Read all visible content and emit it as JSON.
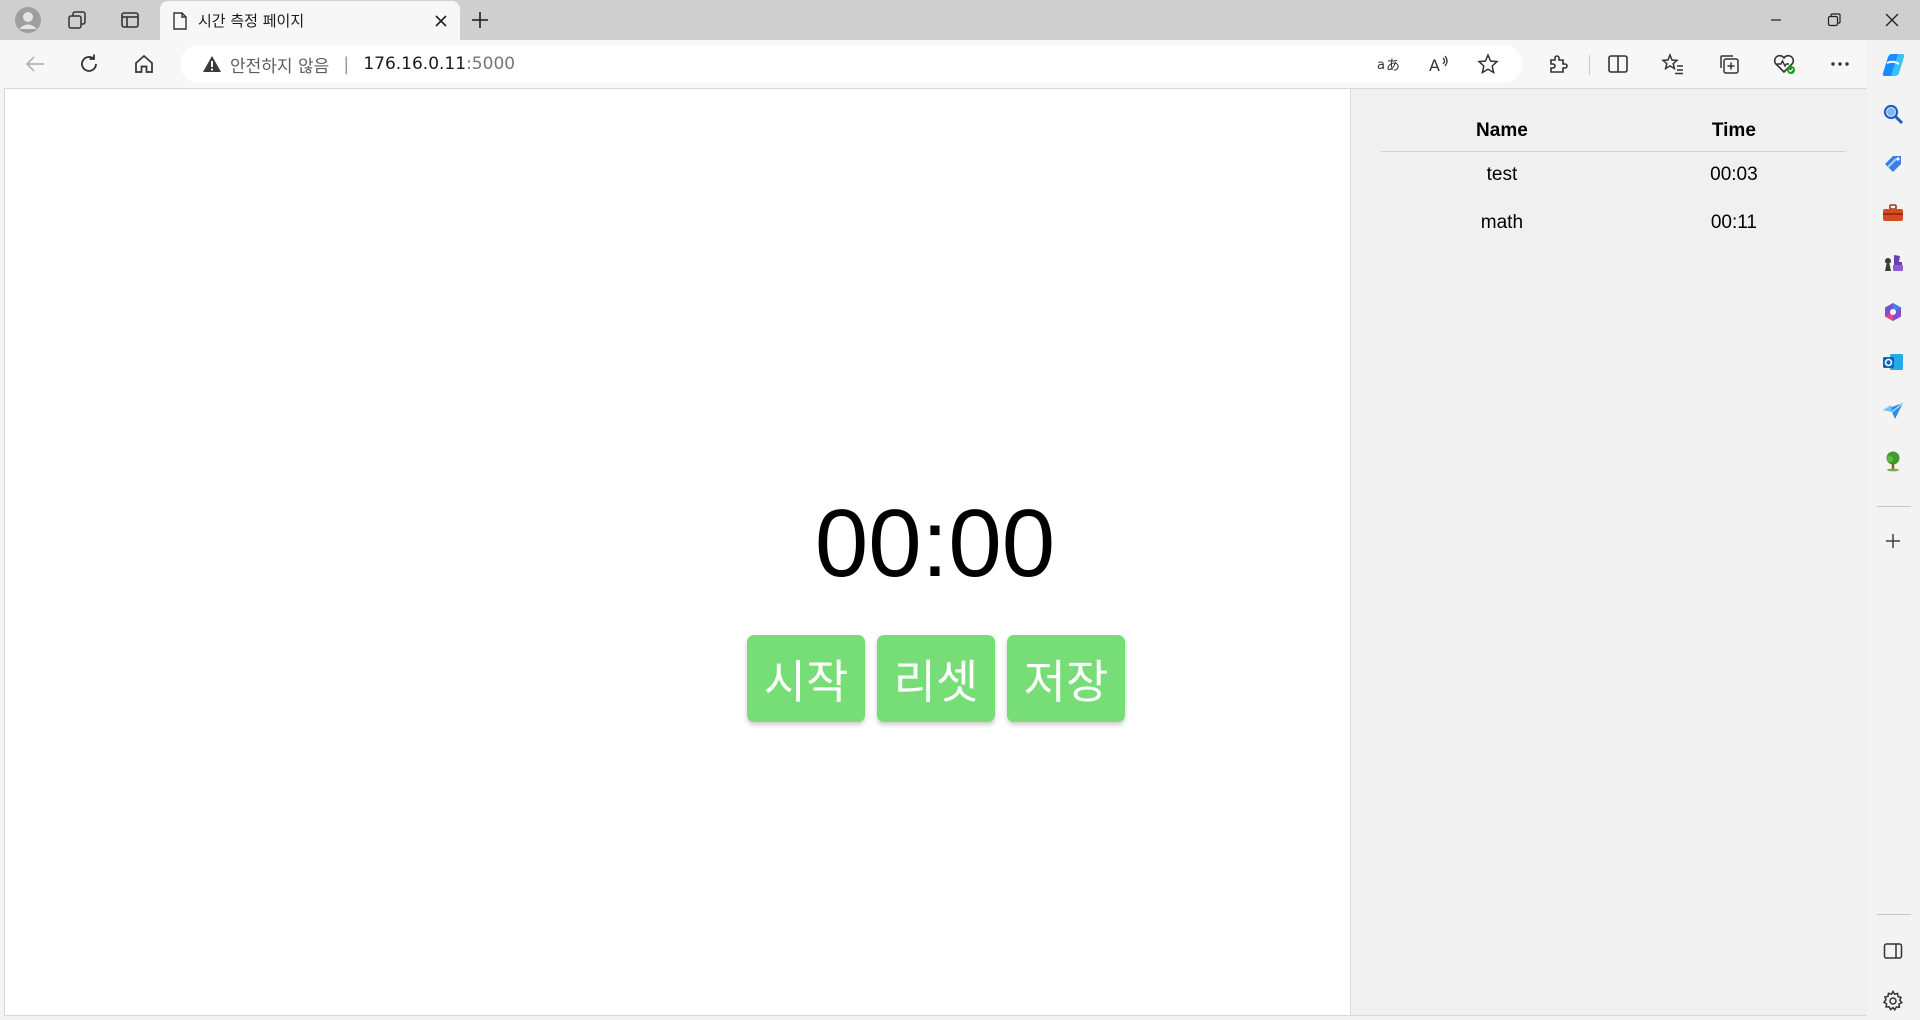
{
  "browser": {
    "tab": {
      "title": "시간 측정 페이지"
    },
    "address_bar": {
      "security_text": "안전하지 않음",
      "url_host": "176.16.0.11",
      "url_port": ":5000"
    },
    "colors": {
      "edge_blue": "#0f6cbd",
      "warning": "#3a3a3a"
    }
  },
  "page": {
    "timer": {
      "display": "00:00"
    },
    "buttons": {
      "start_label": "시작",
      "reset_label": "리셋",
      "save_label": "저장"
    },
    "button_color": "#77dd77",
    "records": {
      "headers": {
        "name": "Name",
        "time": "Time"
      },
      "rows": [
        {
          "name": "test",
          "time": "00:03"
        },
        {
          "name": "math",
          "time": "00:11"
        }
      ]
    }
  }
}
